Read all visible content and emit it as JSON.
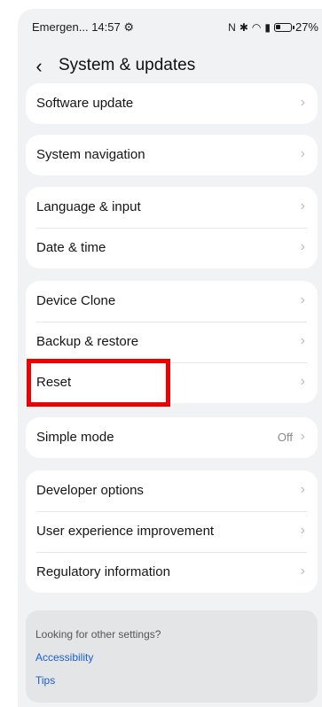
{
  "status_bar": {
    "left_text": "Emergen... 14:57 ⚙",
    "icons": [
      "nfc-icon",
      "bluetooth-icon",
      "wifi-icon",
      "sim-icon",
      "battery-icon"
    ],
    "nfc": "N",
    "bluetooth": "✱",
    "wifi": "◠",
    "sim": "▮",
    "battery_percent": "27%"
  },
  "header": {
    "back_glyph": "‹",
    "title": "System & updates"
  },
  "groups": [
    {
      "items": [
        {
          "label": "Software update"
        }
      ]
    },
    {
      "items": [
        {
          "label": "System navigation"
        }
      ]
    },
    {
      "items": [
        {
          "label": "Language & input"
        },
        {
          "label": "Date & time"
        }
      ]
    },
    {
      "items": [
        {
          "label": "Device Clone"
        },
        {
          "label": "Backup & restore"
        },
        {
          "label": "Reset"
        }
      ]
    },
    {
      "items": [
        {
          "label": "Simple mode",
          "value": "Off"
        }
      ]
    },
    {
      "items": [
        {
          "label": "Developer options"
        },
        {
          "label": "User experience improvement"
        },
        {
          "label": "Regulatory information"
        }
      ]
    }
  ],
  "chevron": "›",
  "help": {
    "question": "Looking for other settings?",
    "links": [
      "Accessibility",
      "Tips"
    ]
  },
  "colors": {
    "highlight": "#ee0000",
    "link": "#1a5fd0",
    "background": "#f1f2f4"
  }
}
